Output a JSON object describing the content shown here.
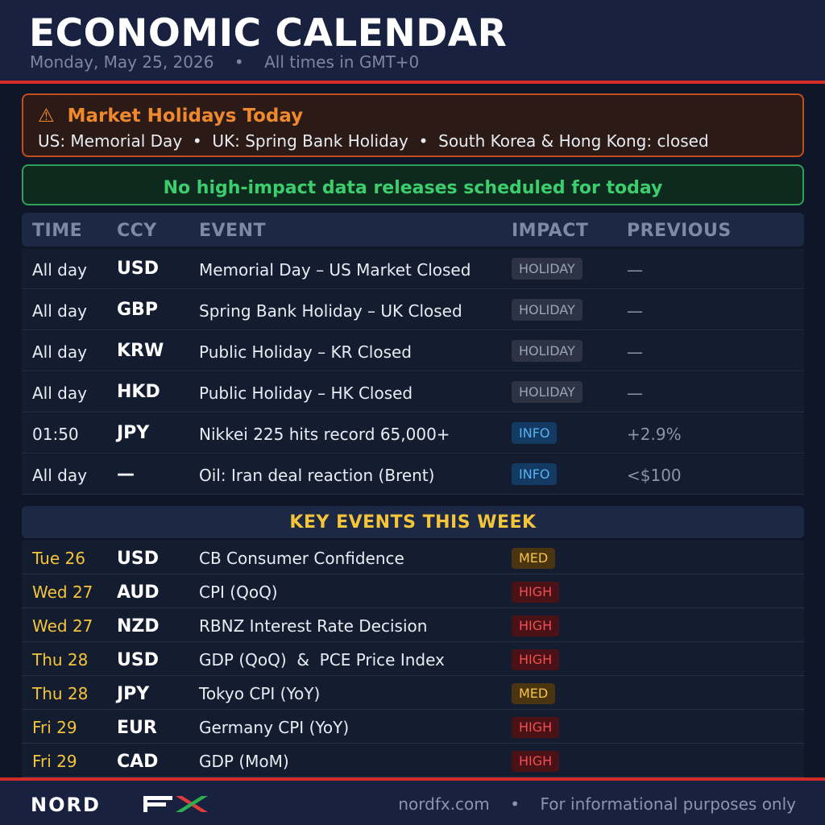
{
  "header": {
    "title": "ECONOMIC CALENDAR",
    "date": "Monday, May 25, 2026",
    "separator": "•",
    "timezone": "All times in GMT+0"
  },
  "holidays": {
    "icon": "warning-icon",
    "title": "Market Holidays Today",
    "text": "US: Memorial Day  •  UK: Spring Bank Holiday  •  South Korea & Hong Kong: closed"
  },
  "notice": "No high-impact data releases scheduled for today",
  "table": {
    "columns": [
      "TIME",
      "CCY",
      "EVENT",
      "IMPACT",
      "PREVIOUS"
    ],
    "rows": [
      {
        "time": "All day",
        "ccy": "USD",
        "event": "Memorial Day – US Market Closed",
        "impact": "HOLIDAY",
        "previous": "—"
      },
      {
        "time": "All day",
        "ccy": "GBP",
        "event": "Spring Bank Holiday – UK Closed",
        "impact": "HOLIDAY",
        "previous": "—"
      },
      {
        "time": "All day",
        "ccy": "KRW",
        "event": "Public Holiday – KR Closed",
        "impact": "HOLIDAY",
        "previous": "—"
      },
      {
        "time": "All day",
        "ccy": "HKD",
        "event": "Public Holiday – HK Closed",
        "impact": "HOLIDAY",
        "previous": "—"
      },
      {
        "time": "01:50",
        "ccy": "JPY",
        "event": "Nikkei 225 hits record 65,000+",
        "impact": "INFO",
        "previous": "+2.9%"
      },
      {
        "time": "All day",
        "ccy": "—",
        "event": "Oil: Iran deal reaction (Brent)",
        "impact": "INFO",
        "previous": "<$100"
      }
    ]
  },
  "week": {
    "title": "KEY EVENTS THIS WEEK",
    "rows": [
      {
        "day": "Tue 26",
        "ccy": "USD",
        "event": "CB Consumer Confidence",
        "impact": "MED"
      },
      {
        "day": "Wed 27",
        "ccy": "AUD",
        "event": "CPI (QoQ)",
        "impact": "HIGH"
      },
      {
        "day": "Wed 27",
        "ccy": "NZD",
        "event": "RBNZ Interest Rate Decision",
        "impact": "HIGH"
      },
      {
        "day": "Thu 28",
        "ccy": "USD",
        "event": "GDP (QoQ)  &  PCE Price Index",
        "impact": "HIGH"
      },
      {
        "day": "Thu 28",
        "ccy": "JPY",
        "event": "Tokyo CPI (YoY)",
        "impact": "MED"
      },
      {
        "day": "Fri 29",
        "ccy": "EUR",
        "event": "Germany CPI (YoY)",
        "impact": "HIGH"
      },
      {
        "day": "Fri 29",
        "ccy": "CAD",
        "event": "GDP (MoM)",
        "impact": "HIGH"
      }
    ]
  },
  "footer": {
    "brand_left": "NORD",
    "brand_right": "FX",
    "site": "nordfx.com",
    "separator": "•",
    "disclaimer": "For informational purposes only"
  },
  "colors": {
    "accent_red": "#d32a2a",
    "warning_orange": "#f0892e",
    "success_green": "#3ccd6c",
    "highlight_yellow": "#f4c53a",
    "impact_high": "#f05050",
    "impact_med": "#f4c34a",
    "impact_info": "#5ab0f0"
  }
}
